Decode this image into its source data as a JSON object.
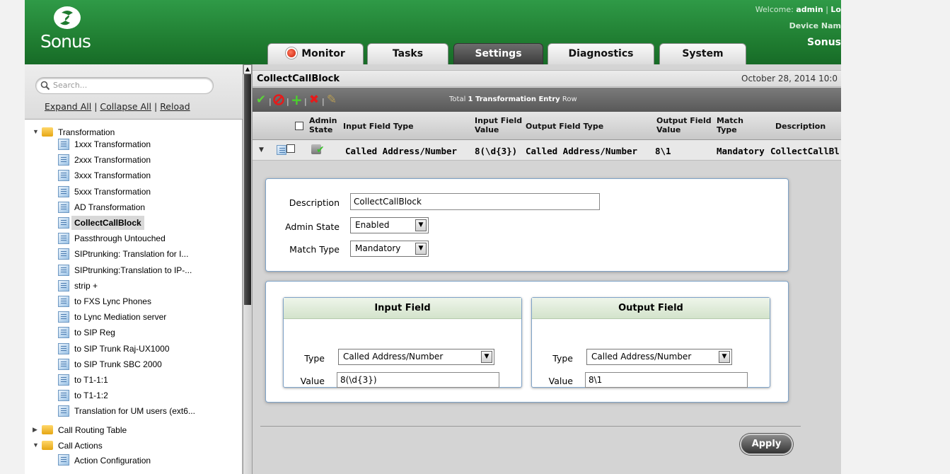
{
  "header": {
    "logo_text": "Sonus",
    "welcome_label": "Welcome:",
    "welcome_user": "admin",
    "welcome_sep": "|",
    "welcome_link": "Lo",
    "device_label": "Device Nam",
    "device_name": "Sonus"
  },
  "tabs": [
    {
      "label": "Monitor",
      "active": false
    },
    {
      "label": "Tasks",
      "active": false
    },
    {
      "label": "Settings",
      "active": true
    },
    {
      "label": "Diagnostics",
      "active": false
    },
    {
      "label": "System",
      "active": false
    }
  ],
  "sidebar": {
    "search_placeholder": "Search...",
    "expand_all": "Expand All",
    "collapse_all": "Collapse All",
    "reload": "Reload",
    "sep": "|",
    "tree": {
      "transformation_label": "Transformation",
      "transformation_items": [
        "1xxx Transformation",
        "2xxx Transformation",
        "3xxx Transformation",
        "5xxx Transformation",
        "AD Transformation",
        "CollectCallBlock",
        "Passthrough Untouched",
        "SIPtrunking: Translation for I...",
        "SIPtrunking:Translation to IP-...",
        "strip +",
        "to FXS Lync Phones",
        "to Lync Mediation server",
        "to SIP Reg",
        "to SIP Trunk Raj-UX1000",
        "to SIP Trunk SBC 2000",
        "to T1-1:1",
        "to T1-1:2",
        "Translation for UM users (ext6..."
      ],
      "selected_item": "CollectCallBlock",
      "call_routing_label": "Call Routing Table",
      "call_actions_label": "Call Actions",
      "action_config_label": "Action Configuration"
    }
  },
  "main": {
    "title": "CollectCallBlock",
    "date": "October 28, 2014 10:0",
    "toolbar": {
      "total_prefix": "Total",
      "total_count": "1 Transformation Entry",
      "total_suffix": "Row"
    },
    "grid_headers": {
      "admin_state_1": "Admin",
      "admin_state_2": "State",
      "input_field_type": "Input Field Type",
      "input_field_value_1": "Input Field",
      "input_field_value_2": "Value",
      "output_field_type": "Output Field Type",
      "output_field_value_1": "Output Field",
      "output_field_value_2": "Value",
      "match_type_1": "Match",
      "match_type_2": "Type",
      "description": "Description"
    },
    "grid_row": {
      "input_field_type": "Called Address/Number",
      "input_field_value": "8(\\d{3})",
      "output_field_type": "Called Address/Number",
      "output_field_value": "8\\1",
      "match_type": "Mandatory",
      "description": "CollectCallBl"
    },
    "form": {
      "description_label": "Description",
      "description_value": "CollectCallBlock",
      "admin_state_label": "Admin State",
      "admin_state_value": "Enabled",
      "match_type_label": "Match Type",
      "match_type_value": "Mandatory"
    },
    "input_field": {
      "title": "Input Field",
      "type_label": "Type",
      "type_value": "Called Address/Number",
      "value_label": "Value",
      "value_value": "8(\\d{3})"
    },
    "output_field": {
      "title": "Output Field",
      "type_label": "Type",
      "type_value": "Called Address/Number",
      "value_label": "Value",
      "value_value": "8\\1"
    },
    "apply_label": "Apply"
  },
  "colors": {
    "header_green": "#1e7a2f",
    "panel_border": "#7fa3c8",
    "toolbar_dark": "#585858"
  },
  "icons": [
    "sonus-logo-icon",
    "search-icon",
    "folder-icon",
    "document-icon",
    "check-icon",
    "disable-icon",
    "add-icon",
    "delete-icon",
    "edit-icon",
    "record-icon",
    "dropdown-arrow-icon"
  ]
}
